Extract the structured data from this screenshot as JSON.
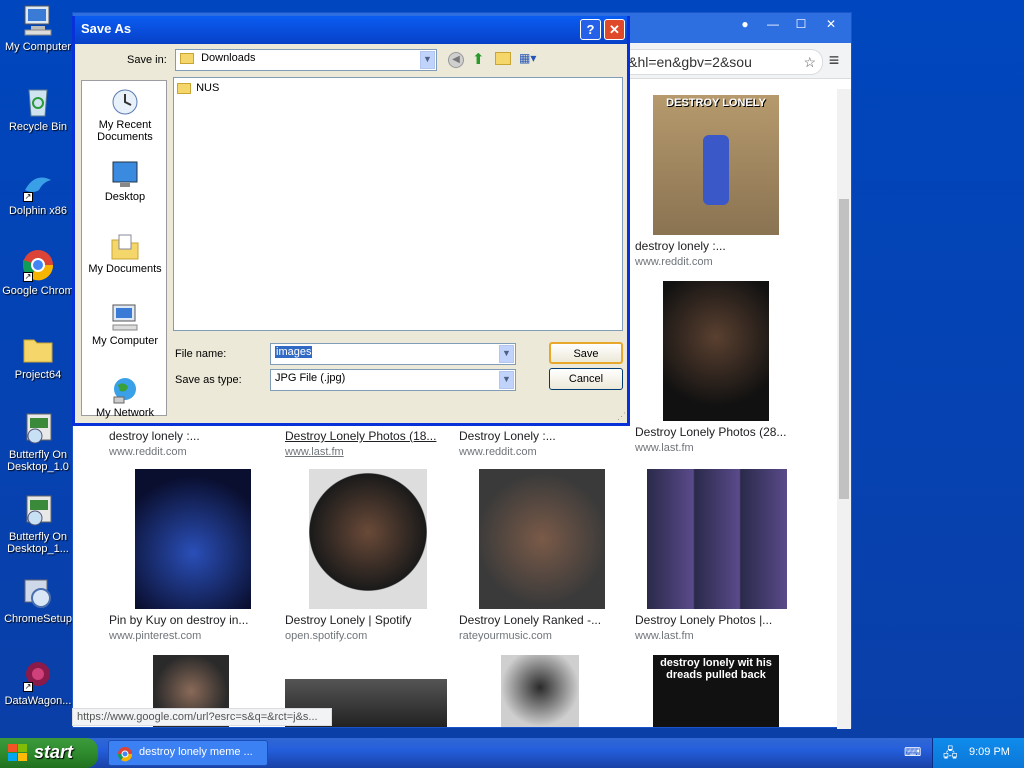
{
  "desktop": {
    "icons": [
      {
        "label": "My Computer",
        "icon": "my-computer-icon"
      },
      {
        "label": "Recycle Bin",
        "icon": "recycle-bin-icon"
      },
      {
        "label": "Dolphin x86",
        "icon": "dolphin-icon"
      },
      {
        "label": "Google Chrom",
        "icon": "chrome-icon"
      },
      {
        "label": "Project64",
        "icon": "folder-icon"
      },
      {
        "label": "Butterfly On Desktop_1.0",
        "icon": "installer-icon"
      },
      {
        "label": "Butterfly On Desktop_1...",
        "icon": "installer-icon"
      },
      {
        "label": "ChromeSetup",
        "icon": "setup-icon"
      },
      {
        "label": "DataWagon...",
        "icon": "datawagon-icon"
      }
    ]
  },
  "browser": {
    "url_fragment": "ic&hl=en&gbv=2&sou",
    "status_url": "https://www.google.com/url?esrc=s&q=&rct=j&s...",
    "results": [
      {
        "caption": "destroy lonely :...",
        "source": "www.reddit.com",
        "meme_text": "DESTROY LONELY"
      },
      {
        "caption": "destroy lonely :...",
        "source": "www.reddit.com"
      },
      {
        "caption": "Destroy Lonely Photos (18...",
        "source": "www.last.fm"
      },
      {
        "caption": "Destroy Lonely :...",
        "source": "www.reddit.com"
      },
      {
        "caption": "Destroy Lonely Photos (28...",
        "source": "www.last.fm"
      },
      {
        "caption": "Pin by Kuy on destroy in...",
        "source": "www.pinterest.com"
      },
      {
        "caption": "Destroy Lonely | Spotify",
        "source": "open.spotify.com"
      },
      {
        "caption": "Destroy Lonely Ranked -...",
        "source": "rateyourmusic.com"
      },
      {
        "caption": "Destroy Lonely Photos |...",
        "source": "www.last.fm"
      },
      {
        "caption": "destroy lonely wit his dreads pulled back",
        "source": ""
      }
    ]
  },
  "dialog": {
    "title": "Save As",
    "save_in_label": "Save in:",
    "save_in_value": "Downloads",
    "places": [
      "My Recent Documents",
      "Desktop",
      "My Documents",
      "My Computer",
      "My Network"
    ],
    "files": [
      {
        "name": "NUS",
        "icon": "folder-icon"
      }
    ],
    "file_name_label": "File name:",
    "file_name_value": "images",
    "save_type_label": "Save as type:",
    "save_type_value": "JPG File (.jpg)",
    "save_label": "Save",
    "cancel_label": "Cancel"
  },
  "taskbar": {
    "start_label": "start",
    "task_label": "destroy lonely meme ...",
    "clock": "9:09 PM"
  },
  "colors": {
    "xp_blue": "#0a5df2",
    "start_green": "#2e8b2e",
    "dialog_bg": "#ece9d8"
  }
}
